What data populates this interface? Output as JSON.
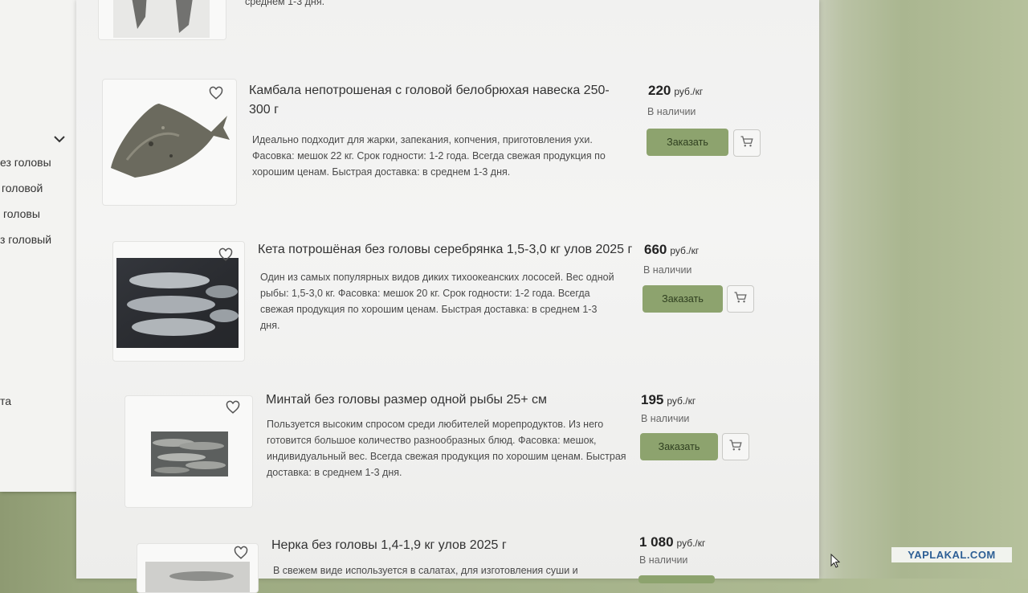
{
  "sidebar": {
    "items": [
      "ез головы",
      "головой",
      "головы",
      "з головый"
    ],
    "last_item": "та"
  },
  "products": [
    {
      "title": "",
      "desc_tail": "среднем 1-3 дня."
    },
    {
      "title": "Камбала непотрошеная с головой белобрюхая навеска 250-300 г",
      "desc": "Идеально подходит для жарки, запекания, копчения, приготовления ухи. Фасовка: мешок 22 кг. Срок годности: 1-2 года. Всегда свежая продукция по хорошим ценам. Быстрая доставка: в среднем 1-3 дня.",
      "price": "220",
      "unit": "руб./кг",
      "stock": "В наличии",
      "order_label": "Заказать"
    },
    {
      "title": "Кета потрошёная без головы серебрянка 1,5-3,0 кг улов 2025 г",
      "desc": "Один из самых популярных видов диких тихоокеанских лососей. Вес одной рыбы: 1,5-3,0 кг. Фасовка: мешок 20 кг. Срок годности: 1-2 года. Всегда свежая продукция по хорошим ценам. Быстрая доставка: в среднем 1-3 дня.",
      "price": "660",
      "unit": "руб./кг",
      "stock": "В наличии",
      "order_label": "Заказать"
    },
    {
      "title": "Минтай без головы размер одной рыбы 25+ см",
      "desc": "Пользуется высоким спросом среди любителей морепродуктов. Из него готовится большое количество разнообразных блюд. Фасовка: мешок, индивидуальный вес. Всегда свежая продукция по хорошим ценам. Быстрая доставка: в среднем 1-3 дня.",
      "price": "195",
      "unit": "руб./кг",
      "stock": "В наличии",
      "order_label": "Заказать"
    },
    {
      "title": "Нерка без головы 1,4-1,9 кг улов 2025 г",
      "desc": "В свежем виде используется в салатах, для изготовления суши и",
      "price": "1 080",
      "unit": "руб./кг",
      "stock": "В наличии"
    }
  ],
  "icons": {
    "favorite": "heart-icon",
    "cart": "cart-icon",
    "expand": "chevron-down-icon"
  },
  "colors": {
    "accent": "#8da36e",
    "watermark_text": "#2d5f95"
  },
  "watermark": "YAPLAKAL.COM"
}
